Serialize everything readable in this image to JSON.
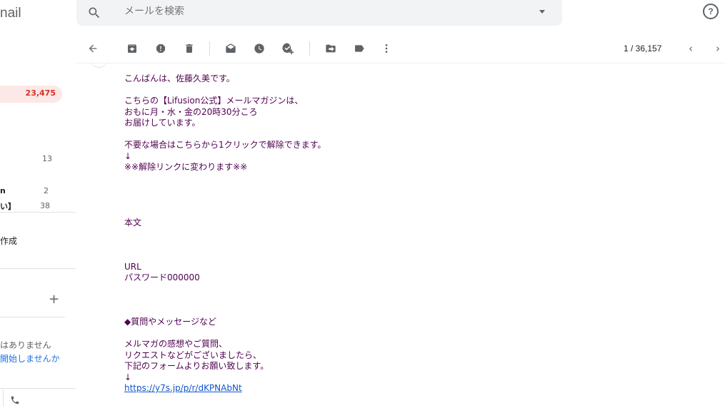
{
  "app": {
    "logo_text": "nail"
  },
  "sidebar": {
    "inbox_count": "23,475",
    "counts": [
      {
        "label": "",
        "count": "13"
      },
      {
        "label": "n",
        "count": "2"
      },
      {
        "label": "い】",
        "count": "38"
      }
    ],
    "create_label": "作成",
    "meet_plus": "+",
    "hangouts_empty": "はありません",
    "hangouts_start_link": "開始しませんか"
  },
  "search": {
    "placeholder": "メールを検索"
  },
  "toolbar": {
    "page_info": "1 / 36,157",
    "prev_symbol": "‹",
    "next_symbol": "›"
  },
  "email": {
    "lines": [
      "こんばんは、佐藤久美です。",
      "",
      "こちらの【Lifusion公式】メールマガジンは、",
      "おもに月・水・金の20時30分ころ",
      "お届けしています。",
      "",
      "不要な場合はこちらから1クリックで解除できます。",
      "↓",
      "※※解除リンクに変わります※※",
      "",
      "",
      "",
      "",
      "本文",
      "",
      "",
      "",
      "URL",
      "パスワード000000",
      "",
      "",
      "",
      "◆質問やメッセージなど",
      "",
      "メルマガの感想やご質問、",
      "リクエストなどがございましたら、",
      "下記のフォームよりお願い致します。",
      "↓"
    ],
    "link": "https://y7s.jp/p/r/dKPNAbNt"
  },
  "colors": {
    "body_text": "#500050",
    "link": "#1155cc",
    "inbox_badge": "#d93025",
    "inbox_bg": "#fce8e6",
    "search_bg": "#f1f3f4"
  },
  "icons": [
    "search-icon",
    "dropdown-caret-icon",
    "help-icon",
    "back-arrow-icon",
    "archive-icon",
    "report-spam-icon",
    "delete-icon",
    "mark-unread-icon",
    "snooze-icon",
    "add-task-icon",
    "move-to-icon",
    "label-icon",
    "more-vert-icon",
    "chevron-left-icon",
    "chevron-right-icon",
    "plus-icon",
    "phone-icon"
  ]
}
